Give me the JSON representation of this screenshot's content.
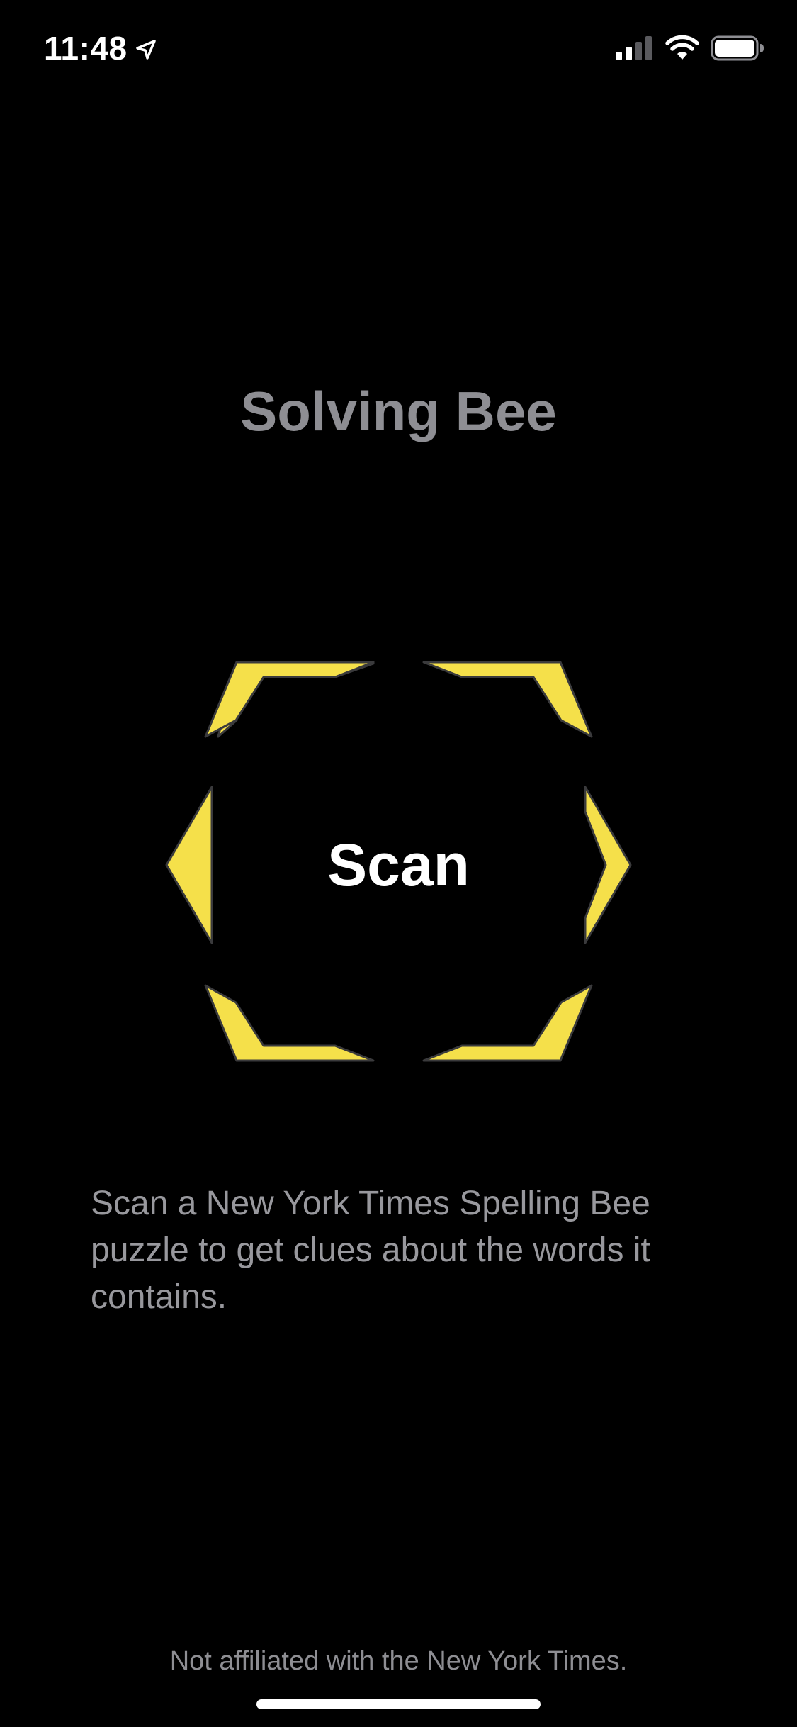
{
  "status_bar": {
    "time": "11:48",
    "icons": [
      "location-arrow-icon",
      "cellular-signal-icon",
      "wifi-icon",
      "battery-icon"
    ]
  },
  "app": {
    "title": "Solving Bee"
  },
  "scan": {
    "label": "Scan",
    "frame_icon": "hexagon-frame-icon",
    "accent_color": "#f5e04a"
  },
  "description": "Scan a New York Times Spelling Bee puzzle to get clues about the words it contains.",
  "disclaimer": "Not affiliated with the New York Times.",
  "colors": {
    "background": "#000000",
    "title": "#8e8e93",
    "body_text": "#98989d",
    "accent": "#f5e04a"
  }
}
